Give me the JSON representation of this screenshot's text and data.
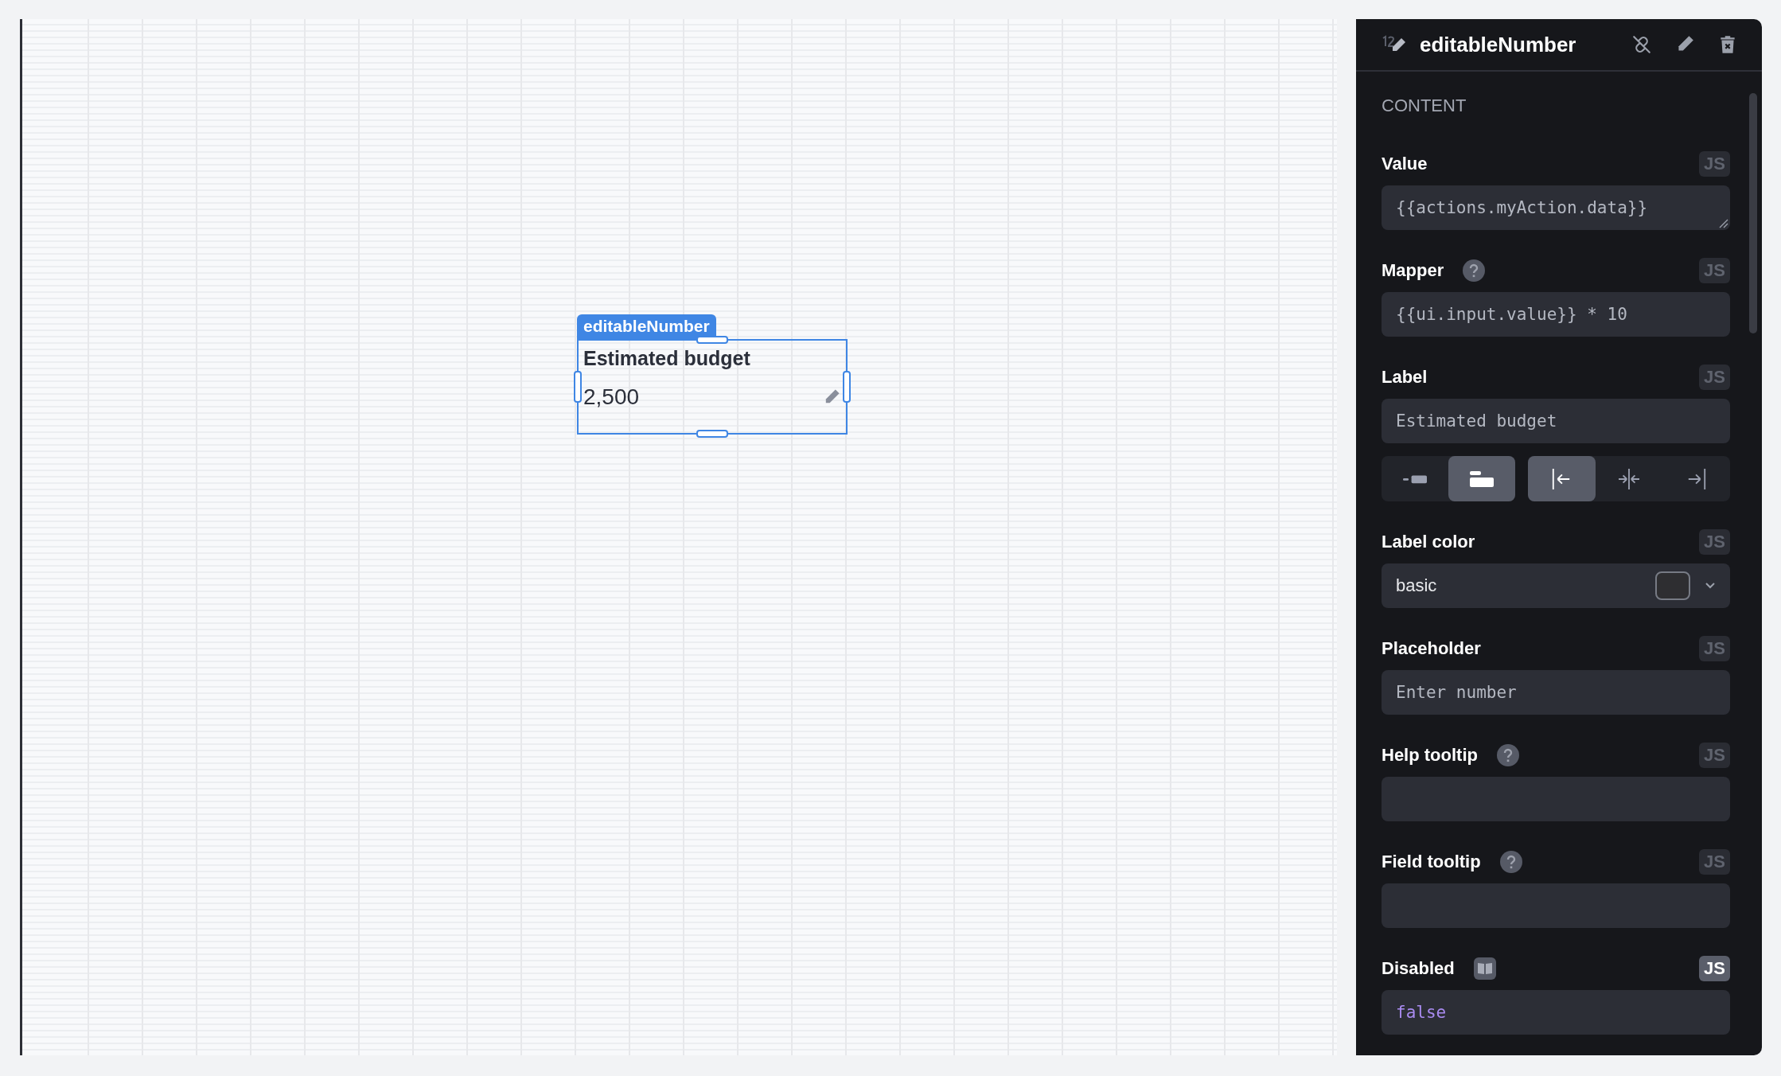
{
  "canvas": {
    "widget": {
      "tag": "editableNumber",
      "label": "Estimated budget",
      "value": "2,500",
      "selected": true
    }
  },
  "panel": {
    "title": "editableNumber",
    "section": "CONTENT",
    "fields": [
      {
        "kind": "text",
        "label": "Value",
        "js_label": "JS",
        "js_active": false,
        "value": "{{actions.myAction.data}}",
        "resizable": true
      },
      {
        "kind": "text",
        "label": "Mapper",
        "help": true,
        "js_label": "JS",
        "js_active": false,
        "value": "{{ui.input.value}} * 10"
      },
      {
        "kind": "text",
        "label": "Label",
        "js_label": "JS",
        "js_active": false,
        "value": "Estimated budget",
        "segments": [
          [
            {
              "kind": "left",
              "selected": false
            },
            {
              "kind": "top",
              "selected": true
            }
          ],
          [
            {
              "kind": "start",
              "selected": true
            },
            {
              "kind": "center",
              "selected": false
            },
            {
              "kind": "end",
              "selected": false
            }
          ]
        ]
      },
      {
        "kind": "select",
        "label": "Label color",
        "js_label": "JS",
        "js_active": false,
        "value": "basic",
        "color": "#2e2e31"
      },
      {
        "kind": "text",
        "label": "Placeholder",
        "js_label": "JS",
        "js_active": false,
        "value": "Enter number"
      },
      {
        "kind": "text",
        "label": "Help tooltip",
        "help": true,
        "js_label": "JS",
        "js_active": false
      },
      {
        "kind": "text",
        "label": "Field tooltip",
        "help": true,
        "js_label": "JS",
        "js_active": false
      },
      {
        "kind": "code",
        "label": "Disabled",
        "docs": true,
        "js_label": "JS",
        "js_active": true,
        "value": "false"
      }
    ]
  }
}
